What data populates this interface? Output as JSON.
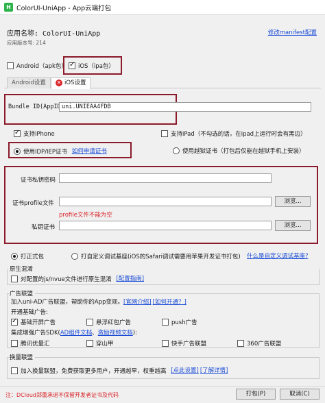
{
  "window": {
    "title": "ColorUI-UniApp - App云端打包",
    "icon": "hbuilder-logo-icon",
    "icon_text": "H"
  },
  "app": {
    "name_label": "应用名称: ColorUI-UniApp",
    "version_label": "应用版本号: 214",
    "manifest_link": "修改manifest配置"
  },
  "platforms": {
    "android_label": "Android（apk包）",
    "ios_label": "iOS（ipa包）",
    "android_checked": false,
    "ios_checked": true
  },
  "tabs": [
    {
      "label": "Android设置",
      "active": false
    },
    {
      "label": "iOS设置",
      "active": true
    }
  ],
  "ios": {
    "bundle_id_label": "Bundle ID(AppID)",
    "bundle_id_value": "uni.UNIEAA4FDB",
    "support_iphone": "支持iPhone",
    "support_ipad": "支持iPad（不勾选的话，在ipad上运行时会有黑边）",
    "use_idp": "使用IDP/IEP证书",
    "how_to_apply": "如何申请证书",
    "use_jailbreak": "使用越狱证书（打包后仅能在越狱手机上安装）",
    "cert_password_label": "证书私钥密码",
    "profile_label": "证书profile文件",
    "profile_error": "profile文件不能为空",
    "private_cert_label": "私钥证书",
    "browse_label": "浏览..."
  },
  "build_type": {
    "formal": "打正式包",
    "custom_debug": "打自定义调试基座(iOS的Safari调试需要用苹果开发证书打包)",
    "what_is_custom": "什么是自定义调试基座?"
  },
  "native_obfuscation": {
    "title": "原生混淆",
    "option": "对配置的js/nvue文件进行原生混淆",
    "guide_link": "[配置指南]"
  },
  "ad_alliance": {
    "title": "广告联盟",
    "intro": "加入uni-AD广告联盟，帮助你的App变现。",
    "official_link": "[官网介绍]",
    "how_to_open_link": "[如何开通？]",
    "basic_title": "开通基础广告:",
    "basic_items": [
      {
        "label": "基础开屏广告",
        "checked": true
      },
      {
        "label": "悬浮红包广告",
        "checked": false
      },
      {
        "label": "push广告",
        "checked": false
      }
    ],
    "sdk_title_prefix": "集成增强广告SDK(",
    "ad_component_doc": "AD组件文档",
    "sdk_sep": "、",
    "reward_video_doc": "激励视频文档",
    "sdk_title_suffix": "):",
    "sdk_items": [
      {
        "label": "腾讯优量汇",
        "checked": false
      },
      {
        "label": "穿山甲",
        "checked": false
      },
      {
        "label": "快手广告联盟",
        "checked": false
      },
      {
        "label": "360广告联盟",
        "checked": false
      }
    ]
  },
  "exchange": {
    "title": "换量联盟",
    "option": "加入换量联盟，免费获取更多用户，开通越早，权重越高",
    "settings_link": "[点此设置]",
    "learn_link": "[了解详情]"
  },
  "footer": {
    "notice": "注：DCloud郑重承诺不保留开发者证书及代码",
    "pack_button": "打包(P)",
    "cancel_button": "取消(C)"
  },
  "colors": {
    "highlight_box": "#8b1a2b",
    "link": "#1a4bd6",
    "error": "#d9262b",
    "success_icon": "#2db34a"
  }
}
